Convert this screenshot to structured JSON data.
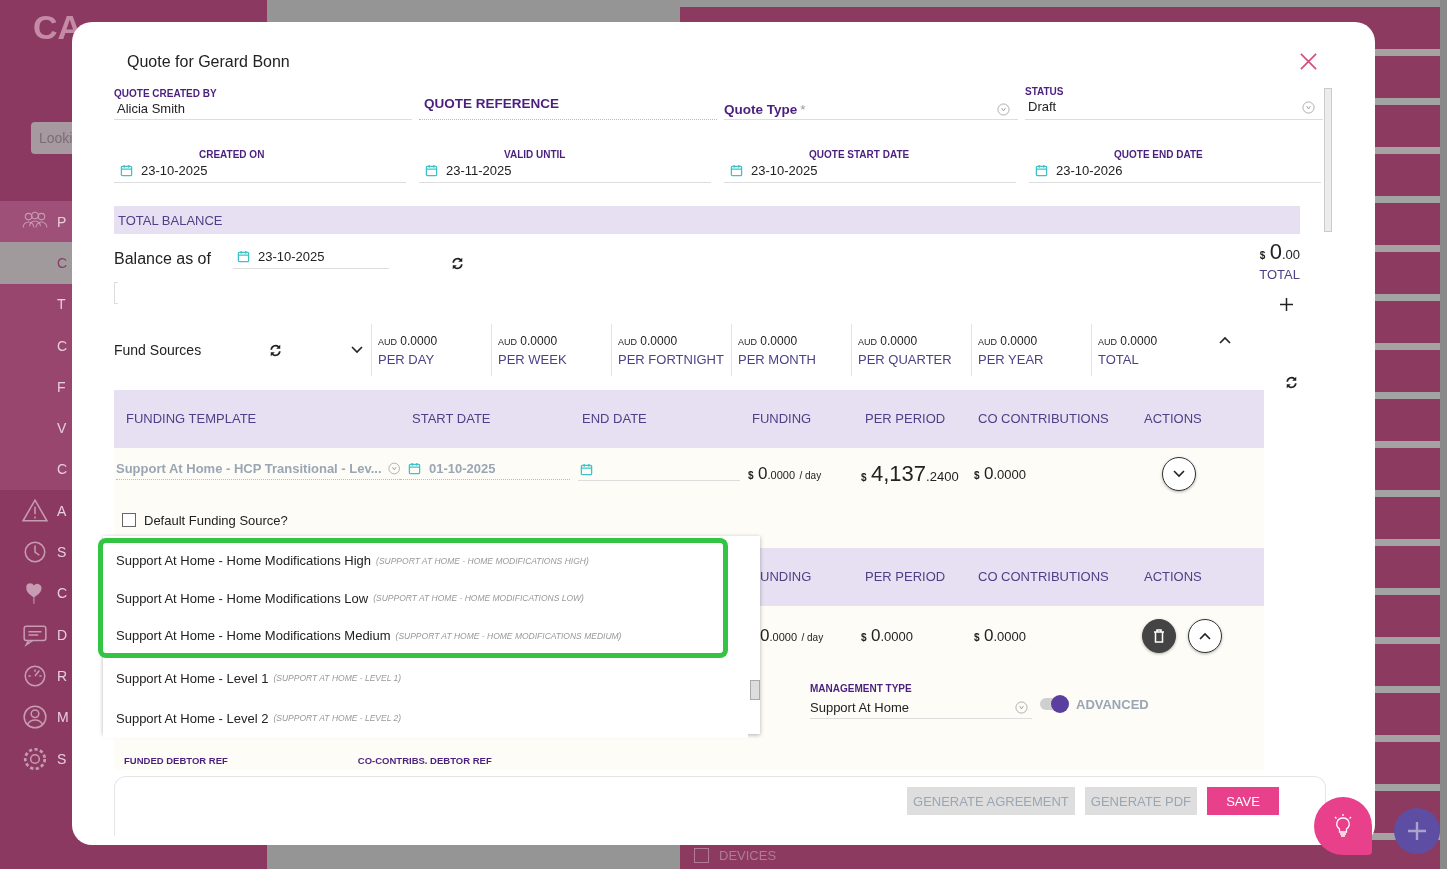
{
  "app": {
    "logo": "CA",
    "search_placeholder": "Looki",
    "nav": [
      {
        "label": "P",
        "kind": "group",
        "selected": false
      },
      {
        "label": "C",
        "kind": "sub",
        "selected": true
      },
      {
        "label": "T",
        "kind": "sub",
        "selected": false
      },
      {
        "label": "C",
        "kind": "sub",
        "selected": false
      },
      {
        "label": "F",
        "kind": "sub",
        "selected": false
      },
      {
        "label": "V",
        "kind": "sub",
        "selected": false
      },
      {
        "label": "C",
        "kind": "sub",
        "selected": false
      },
      {
        "label": "A",
        "kind": "main",
        "selected": false
      },
      {
        "label": "S",
        "kind": "main",
        "selected": false
      },
      {
        "label": "C",
        "kind": "main",
        "selected": false
      },
      {
        "label": "D",
        "kind": "main",
        "selected": false
      },
      {
        "label": "R",
        "kind": "main",
        "selected": false
      },
      {
        "label": "M",
        "kind": "main",
        "selected": false
      },
      {
        "label": "S",
        "kind": "main",
        "selected": false
      }
    ],
    "list_footer": {
      "label": "DEVICES",
      "checked": false
    }
  },
  "modal": {
    "title": "Quote for Gerard Bonn",
    "fields": [
      {
        "kind": "text",
        "label": "QUOTE CREATED BY",
        "value": "Alicia Smith"
      },
      {
        "kind": "heading",
        "label": "QUOTE REFERENCE"
      },
      {
        "kind": "select",
        "label": "Quote Type",
        "required_mark": "*"
      },
      {
        "kind": "select-value",
        "label": "STATUS",
        "value": "Draft"
      }
    ],
    "dates": [
      {
        "label": "CREATED ON",
        "value": "23-10-2025"
      },
      {
        "label": "VALID UNTIL",
        "value": "23-11-2025"
      },
      {
        "label": "QUOTE START DATE",
        "value": "23-10-2025"
      },
      {
        "label": "QUOTE END DATE",
        "value": "23-10-2026"
      }
    ],
    "total_balance": {
      "title": "TOTAL BALANCE",
      "balance_label": "Balance as of",
      "balance_date": "23-10-2025",
      "total": {
        "currency": "$",
        "whole": "0",
        "fraction": ".00"
      },
      "total_label": "TOTAL"
    },
    "fund_sources": {
      "label": "Fund Sources",
      "stats": [
        {
          "currency": "AUD",
          "amount": "0.0000",
          "period": "PER DAY"
        },
        {
          "currency": "AUD",
          "amount": "0.0000",
          "period": "PER WEEK"
        },
        {
          "currency": "AUD",
          "amount": "0.0000",
          "period": "PER FORTNIGHT"
        },
        {
          "currency": "AUD",
          "amount": "0.0000",
          "period": "PER MONTH"
        },
        {
          "currency": "AUD",
          "amount": "0.0000",
          "period": "PER QUARTER"
        },
        {
          "currency": "AUD",
          "amount": "0.0000",
          "period": "PER YEAR"
        },
        {
          "currency": "AUD",
          "amount": "0.0000",
          "period": "TOTAL"
        }
      ]
    },
    "table": {
      "columns": [
        "FUNDING TEMPLATE",
        "START DATE",
        "END DATE",
        "FUNDING",
        "PER PERIOD",
        "CO CONTRIBUTIONS",
        "ACTIONS"
      ],
      "row": {
        "template": "Support At Home - HCP Transitional - Lev...",
        "start_date": "01-10-2025",
        "funding": {
          "currency": "$",
          "whole": "0",
          "fraction": ".0000",
          "unit": "/ day"
        },
        "per_period": {
          "currency": "$",
          "whole": "4,137",
          "fraction": ".2400"
        },
        "co_contributions": {
          "currency": "$",
          "whole": "0",
          "fraction": ".0000"
        }
      },
      "default_checkbox": {
        "label": "Default Funding Source?",
        "checked": false
      }
    },
    "table2": {
      "columns": [
        "UNDING",
        "PER PERIOD",
        "CO CONTRIBUTIONS",
        "ACTIONS"
      ],
      "row": {
        "funding": {
          "whole": "0",
          "fraction": ".0000",
          "unit": "/ day"
        },
        "per_period": {
          "currency": "$",
          "whole": "0",
          "fraction": ".0000"
        },
        "co_contributions": {
          "currency": "$",
          "whole": "0",
          "fraction": ".0000"
        }
      },
      "management_type": {
        "label": "MANAGEMENT TYPE",
        "value": "Support At Home"
      },
      "advanced": {
        "label": "ADVANCED",
        "on": true
      }
    },
    "debtor_refs": [
      "FUNDED DEBTOR REF",
      "CO-CONTRIBS. DEBTOR REF"
    ],
    "buttons": [
      {
        "label": "GENERATE AGREEMENT",
        "disabled": true
      },
      {
        "label": "GENERATE PDF",
        "disabled": true
      },
      {
        "label": "SAVE",
        "disabled": false
      }
    ],
    "dropdown": [
      {
        "label": "Support At Home - Home Modifications High",
        "code": "(SUPPORT AT HOME - HOME MODIFICATIONS HIGH)",
        "highlighted": true
      },
      {
        "label": "Support At Home - Home Modifications Low",
        "code": "(SUPPORT AT HOME - HOME MODIFICATIONS LOW)",
        "highlighted": true
      },
      {
        "label": "Support At Home - Home Modifications Medium",
        "code": "(SUPPORT AT HOME - HOME MODIFICATIONS MEDIUM)",
        "highlighted": true
      },
      {
        "label": "Support At Home - Level 1",
        "code": "(SUPPORT AT HOME - LEVEL 1)",
        "highlighted": false
      },
      {
        "label": "Support At Home - Level 2",
        "code": "(SUPPORT AT HOME - LEVEL 2)",
        "highlighted": false
      }
    ]
  }
}
